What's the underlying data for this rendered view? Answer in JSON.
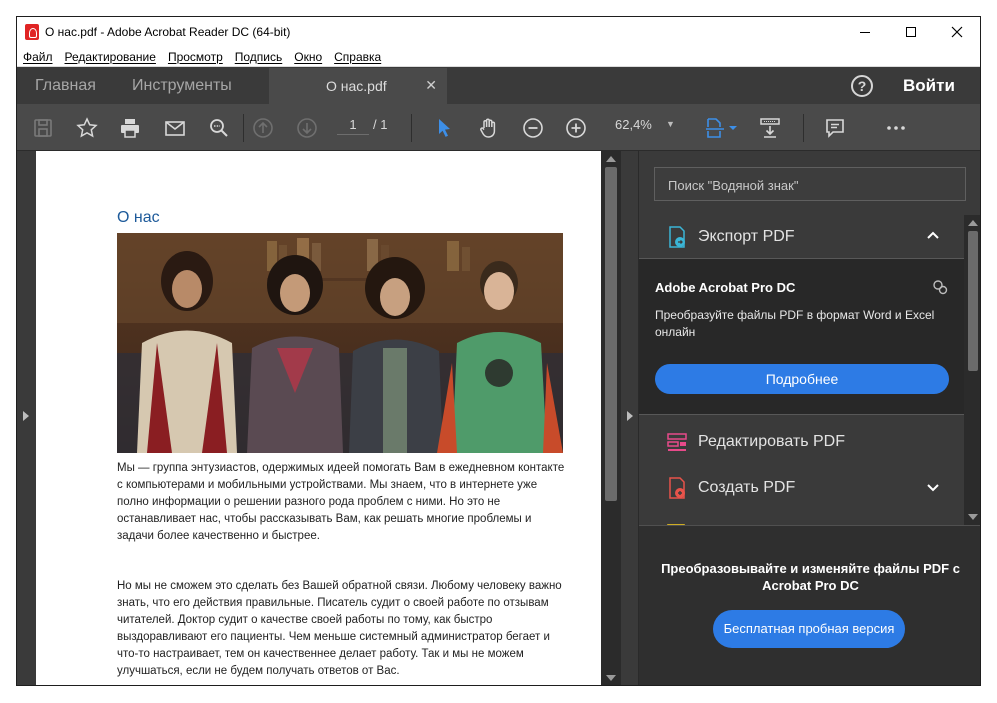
{
  "window": {
    "title": "О нас.pdf - Adobe Acrobat Reader DC (64-bit)"
  },
  "menu": [
    "Файл",
    "Редактирование",
    "Просмотр",
    "Подпись",
    "Окно",
    "Справка"
  ],
  "tabs": {
    "home": "Главная",
    "tools": "Инструменты",
    "document": "О нас.pdf",
    "signin": "Войти",
    "help": "?"
  },
  "toolbar": {
    "page_current": "1",
    "page_total": "/ 1",
    "zoom": "62,4%"
  },
  "document": {
    "heading": "О нас",
    "paragraph1": "Мы — группа энтузиастов, одержимых идеей помогать Вам в ежедневном контакте с компьютерами и мобильными устройствами. Мы знаем, что в интернете уже полно информации о решении разного рода проблем с ними. Но это не останавливает нас, чтобы рассказывать Вам, как решать многие проблемы и задачи более качественно и быстрее.",
    "paragraph2": "Но мы не сможем это сделать без Вашей обратной связи. Любому человеку важно знать, что его действия правильные. Писатель судит о своей работе по отзывам читателей. Доктор судит о качестве своей работы по тому, как быстро выздоравливают его пациенты. Чем меньше системный администратор бегает и что-то настраивает, тем он качественнее делает работу. Так и мы не можем улучшаться, если не будем получать ответов от Вас."
  },
  "right_panel": {
    "search_placeholder": "Поиск \"Водяной знак\"",
    "tools": {
      "export": "Экспорт PDF",
      "edit": "Редактировать PDF",
      "create": "Создать PDF"
    },
    "promo": {
      "title": "Adobe Acrobat Pro DC",
      "description": "Преобразуйте файлы PDF в формат Word и Excel онлайн",
      "button": "Подробнее"
    },
    "footer": {
      "text": "Преобразовывайте и изменяйте файлы PDF с Acrobat Pro DC",
      "button": "Бесплатная пробная версия"
    }
  },
  "colors": {
    "accent": "#2d7be5",
    "heading": "#1d5a9a",
    "pdf_red": "#e02424",
    "pointer_blue": "#3d8fe8"
  }
}
